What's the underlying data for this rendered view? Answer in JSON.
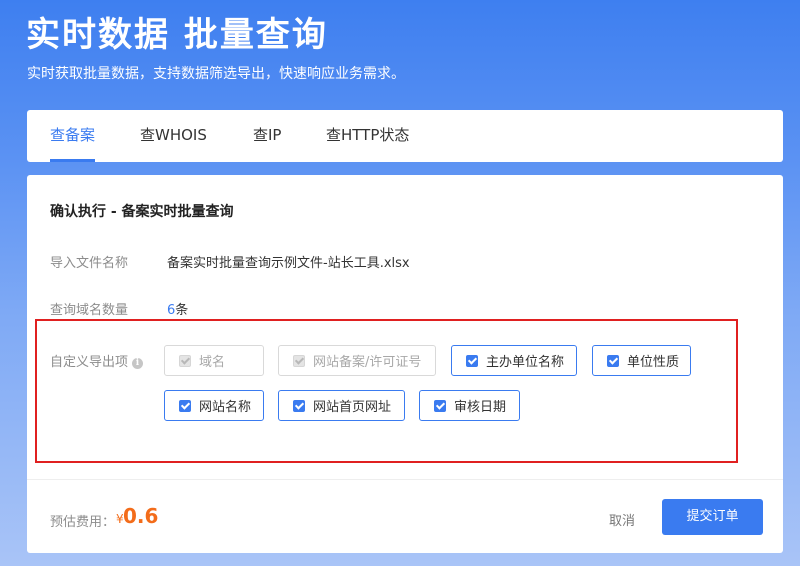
{
  "hero": {
    "title": "实时数据 批量查询",
    "subtitle": "实时获取批量数据，支持数据筛选导出，快速响应业务需求。"
  },
  "tabs": [
    {
      "label": "查备案",
      "active": true
    },
    {
      "label": "查WHOIS",
      "active": false
    },
    {
      "label": "查IP",
      "active": false
    },
    {
      "label": "查HTTP状态",
      "active": false
    }
  ],
  "confirm": {
    "title": "确认执行 - 备案实时批量查询",
    "file_label": "导入文件名称",
    "file_name": "备案实时批量查询示例文件-站长工具.xlsx",
    "count_label": "查询域名数量",
    "count_value": "6",
    "count_unit": "条",
    "export_label": "自定义导出项",
    "export_options": [
      {
        "label": "域名",
        "checked": true,
        "disabled": true
      },
      {
        "label": "网站备案/许可证号",
        "checked": true,
        "disabled": true
      },
      {
        "label": "主办单位名称",
        "checked": true,
        "disabled": false
      },
      {
        "label": "单位性质",
        "checked": true,
        "disabled": false
      },
      {
        "label": "网站名称",
        "checked": true,
        "disabled": false
      },
      {
        "label": "网站首页网址",
        "checked": true,
        "disabled": false
      },
      {
        "label": "审核日期",
        "checked": true,
        "disabled": false
      }
    ]
  },
  "footer": {
    "fee_label": "预估费用：",
    "currency": "¥",
    "amount": "0.6",
    "cancel_label": "取消",
    "submit_label": "提交订单"
  },
  "colors": {
    "accent": "#3a7bf0",
    "price": "#f36c1a",
    "highlight": "#e02020"
  }
}
